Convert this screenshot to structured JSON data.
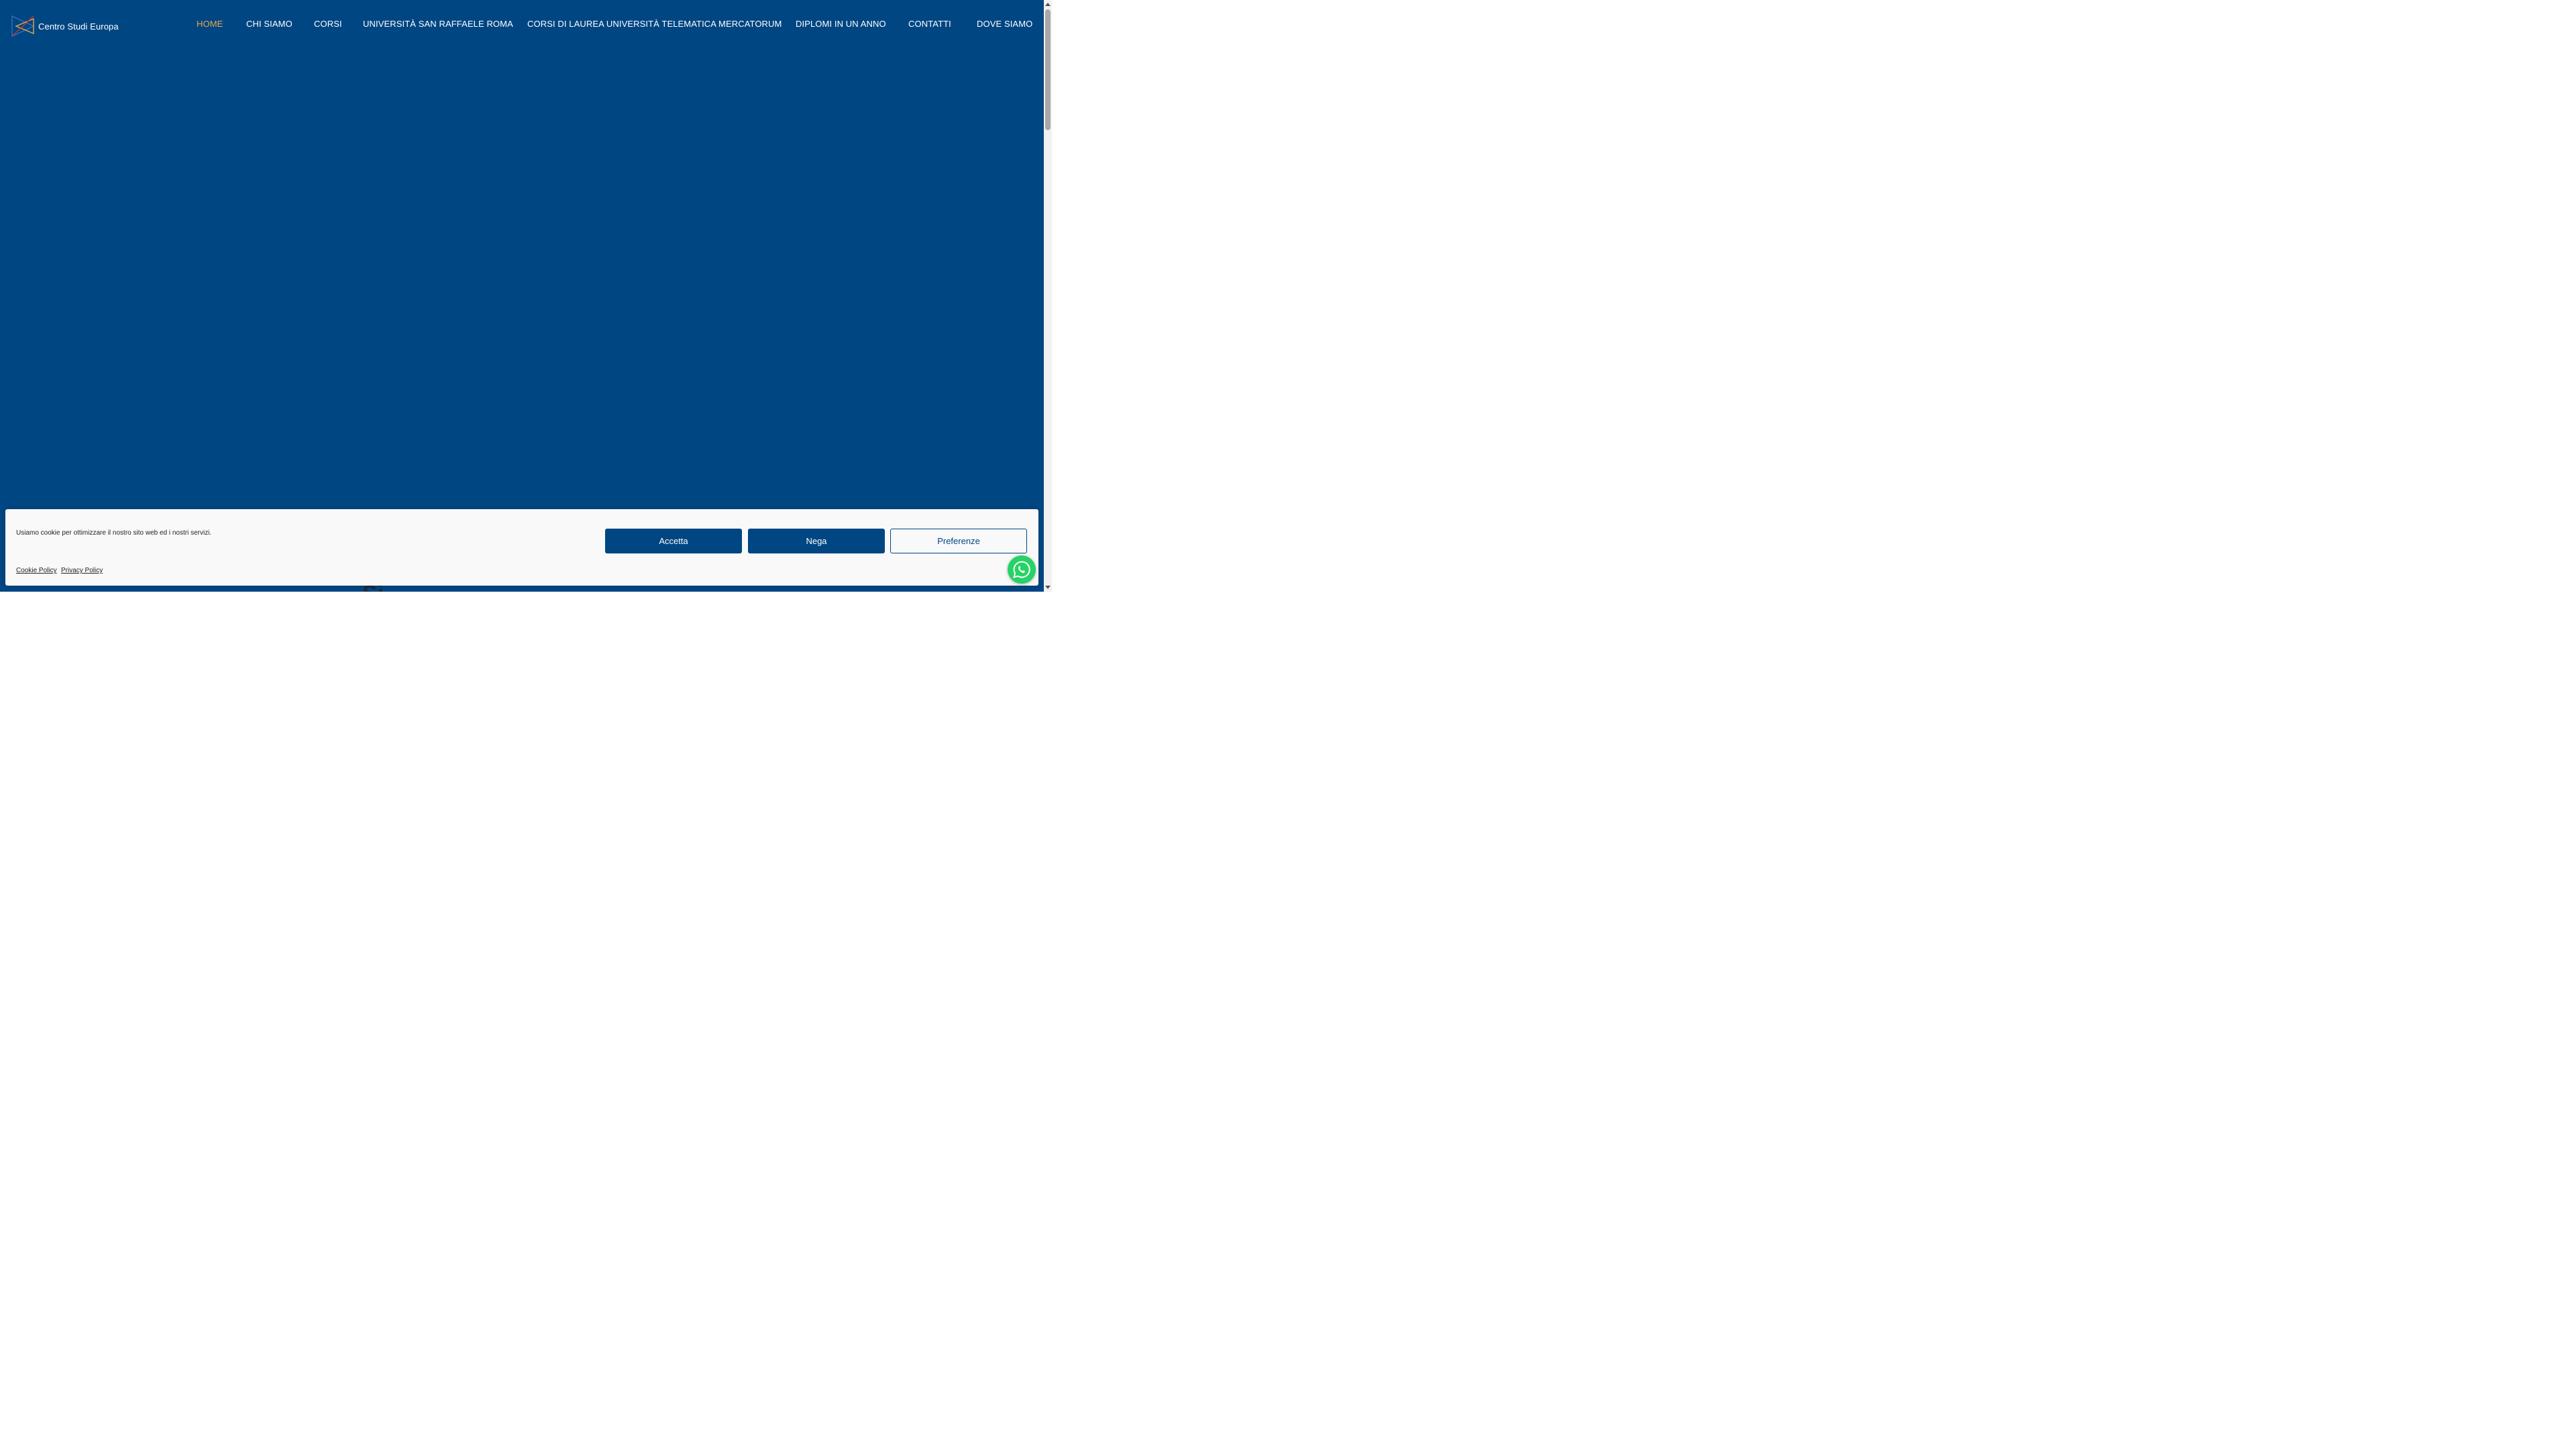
{
  "brand": {
    "name": "Centro Studi Europa",
    "logo_colors": [
      "#3a6bb5",
      "#e8a847",
      "#c43d2b"
    ]
  },
  "nav": {
    "items": [
      {
        "label": "HOME",
        "active": true
      },
      {
        "label": "CHI SIAMO",
        "active": false
      },
      {
        "label": "CORSI",
        "active": false
      },
      {
        "label": "UNIVERSITÀ SAN RAFFAELE ROMA",
        "active": false
      },
      {
        "label": "CORSI DI LAUREA UNIVERSITÀ TELEMATICA MERCATORUM",
        "active": false
      },
      {
        "label": "DIPLOMI IN UN ANNO",
        "active": false
      },
      {
        "label": "CONTATTI",
        "active": false
      },
      {
        "label": "DOVE SIAMO",
        "active": false
      }
    ],
    "active_color": "#e8a847",
    "text_color": "#ffffff"
  },
  "hero": {
    "background_color": "#004683"
  },
  "cookie_banner": {
    "message": "Usiamo cookie per ottimizzare il nostro sito web ed i nostri servizi.",
    "accept_label": "Accetta",
    "deny_label": "Nega",
    "preferences_label": "Preferenze",
    "links": {
      "cookie_policy": "Cookie Policy",
      "privacy_policy": "Privacy Policy"
    }
  },
  "chat_widget": {
    "icon": "whatsapp-icon",
    "color": "#25d366"
  }
}
